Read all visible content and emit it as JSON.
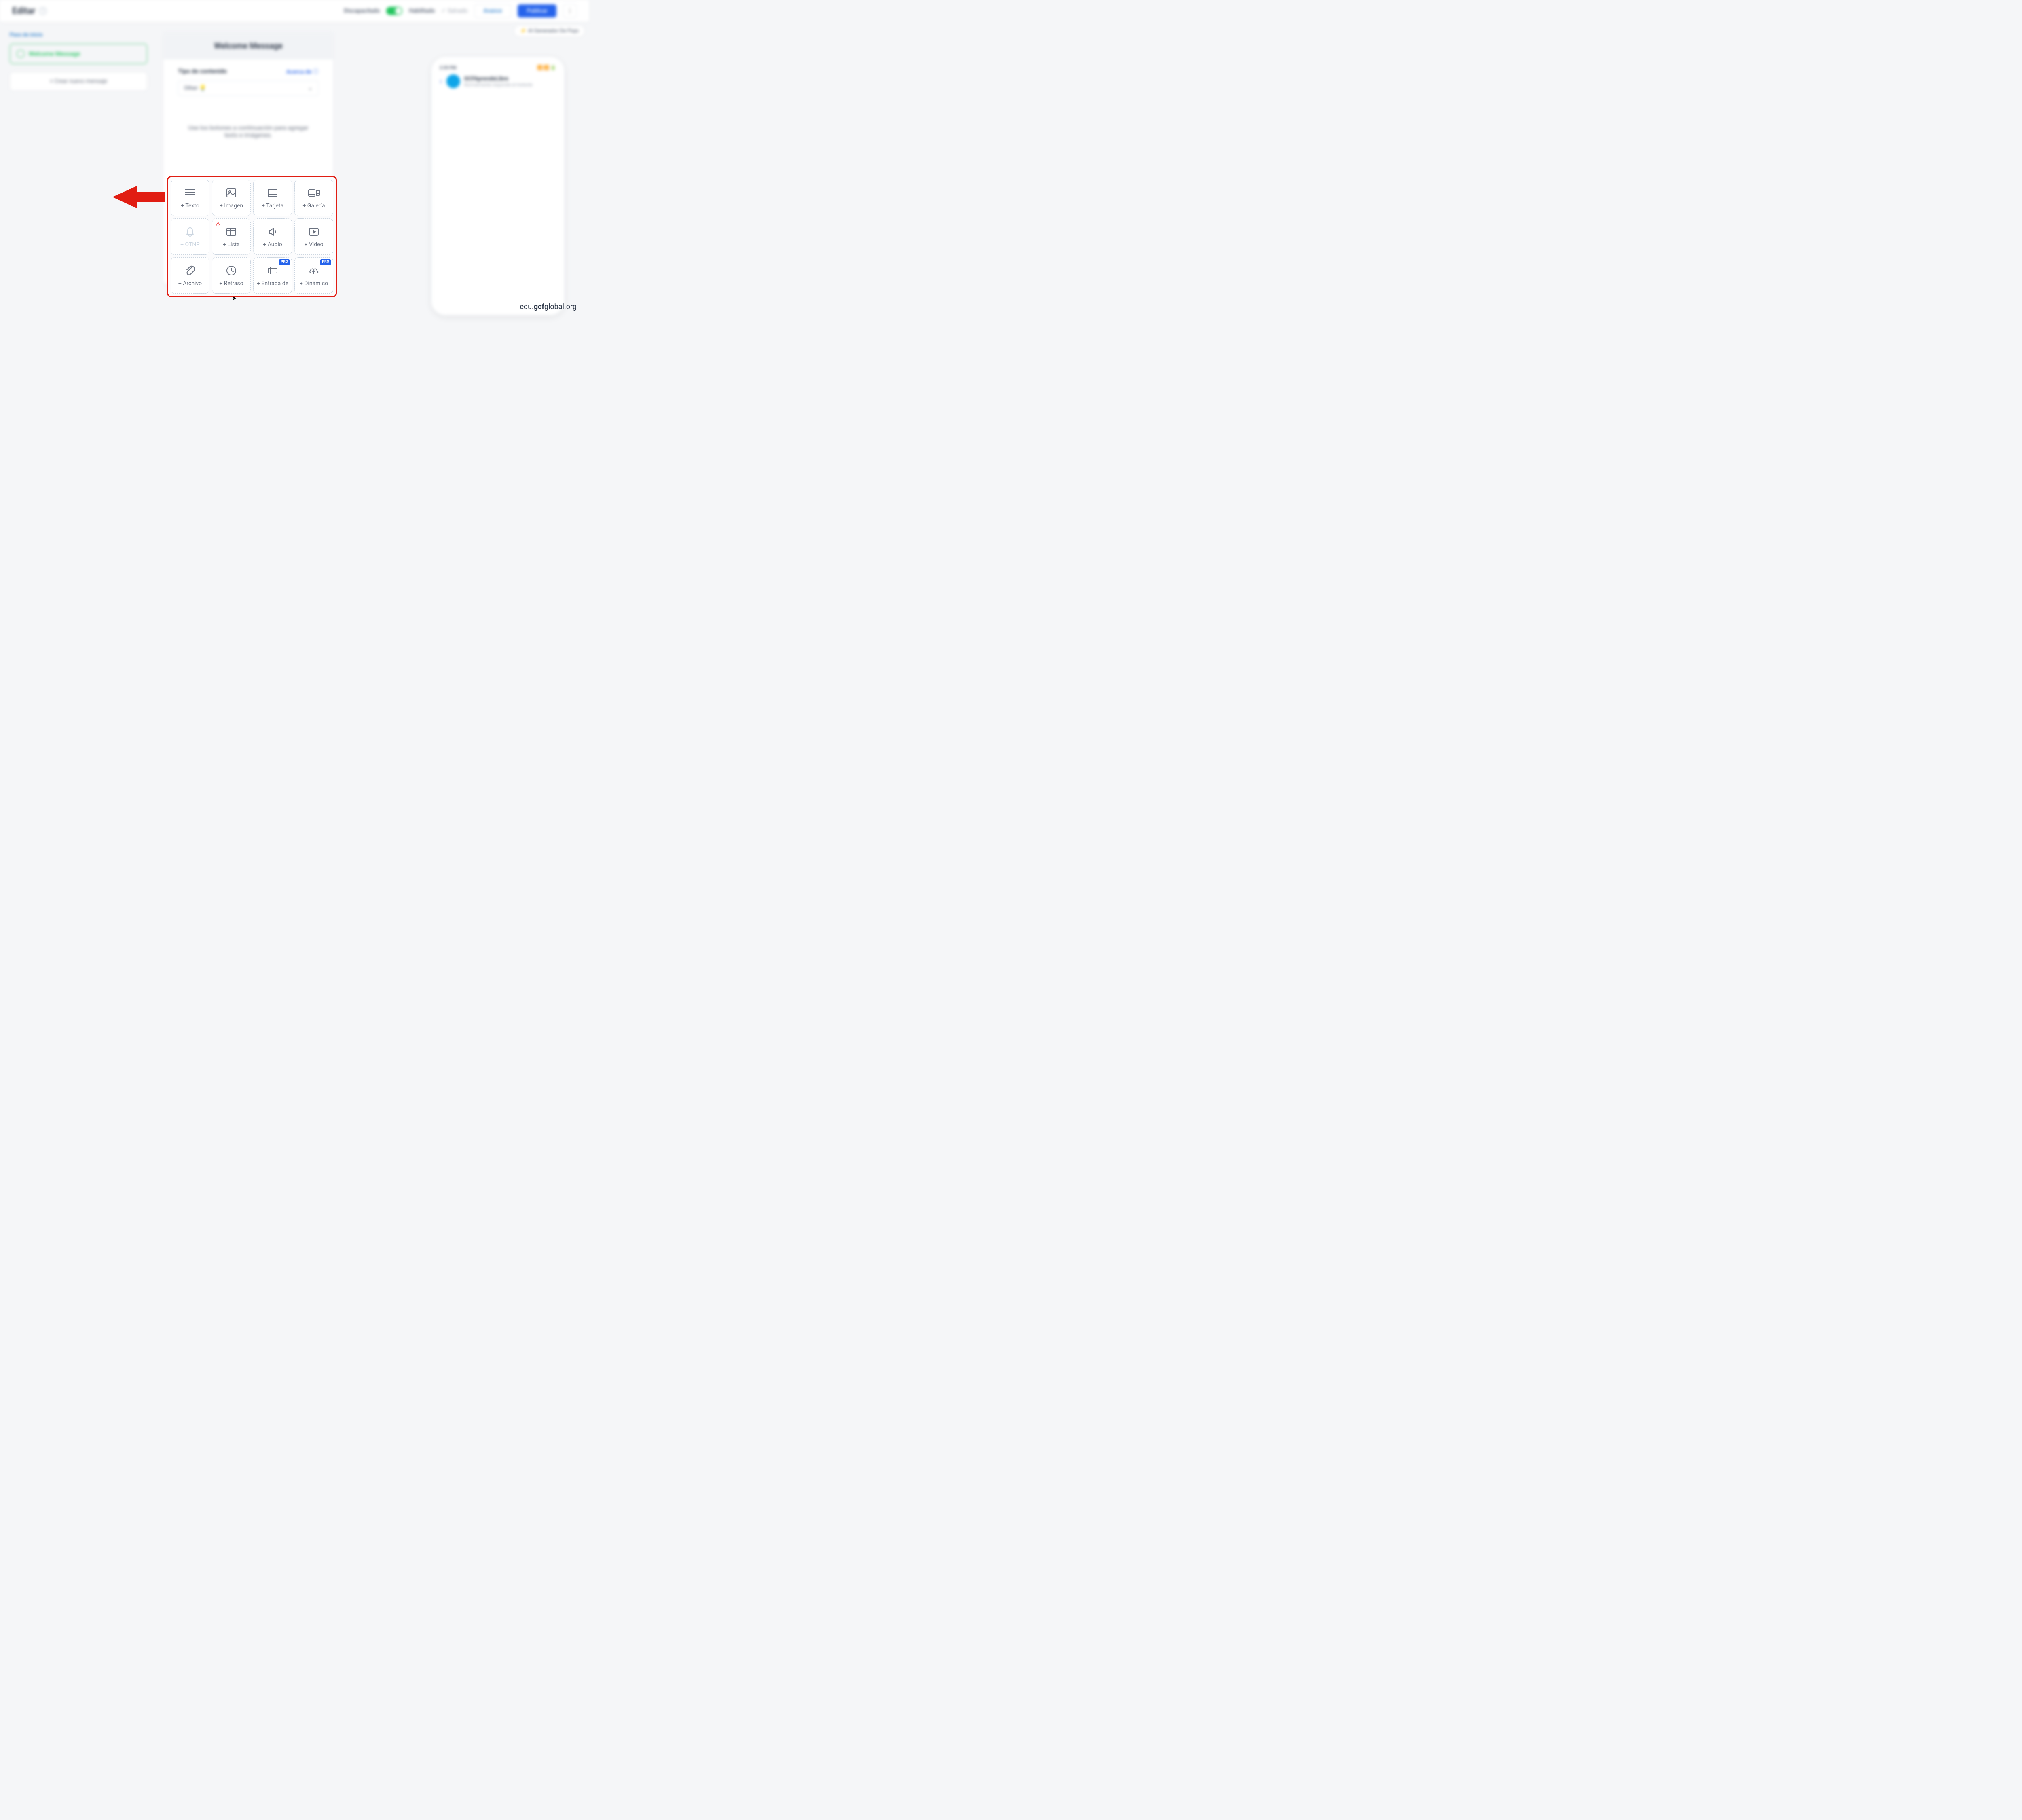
{
  "topbar": {
    "title": "Editar",
    "disabled_label": "Discapacitado",
    "enabled_label": "Habilitado",
    "saved_label": "Salvado",
    "advance_btn": "Avance",
    "publish_btn": "Publicar"
  },
  "pill": {
    "label": "⚡ AI Generador De Flujo"
  },
  "left": {
    "section": "Paso de inicio",
    "step_name": "Welcome Message",
    "create_btn": "+ Crear nuevo mensaje"
  },
  "center": {
    "header": "Welcome Message",
    "content_type_label": "Tipo de contenido",
    "about_link": "Acerca de ⓘ",
    "select_value": "Other 💡",
    "hint": "Use los botones a continuación para agregar texto e imágenes."
  },
  "phone": {
    "time": "2:39 PM",
    "indicators": "📶 📶 🔋",
    "name": "GCFAprendeLibre",
    "subtitle": "Normalmente responde al instante"
  },
  "tiles": [
    {
      "key": "text",
      "label": "+ Texto",
      "icon": "text-lines-icon"
    },
    {
      "key": "image",
      "label": "+ Imagen",
      "icon": "image-icon"
    },
    {
      "key": "card",
      "label": "+ Tarjeta",
      "icon": "card-icon"
    },
    {
      "key": "gallery",
      "label": "+ Galería",
      "icon": "gallery-icon"
    },
    {
      "key": "otnr",
      "label": "+ OTNR",
      "icon": "bell-icon",
      "disabled": true
    },
    {
      "key": "list",
      "label": "+ Lista",
      "icon": "table-icon",
      "warn": true
    },
    {
      "key": "audio",
      "label": "+ Audio",
      "icon": "speaker-icon"
    },
    {
      "key": "video",
      "label": "+ Video",
      "icon": "play-icon"
    },
    {
      "key": "file",
      "label": "+ Archivo",
      "icon": "clip-icon"
    },
    {
      "key": "delay",
      "label": "+ Retraso",
      "icon": "clock-icon"
    },
    {
      "key": "input",
      "label": "+ Entrada de",
      "icon": "input-icon",
      "pro": true
    },
    {
      "key": "dynamic",
      "label": "+ Dinámico",
      "icon": "cloud-icon",
      "pro": true
    }
  ],
  "badges": {
    "pro": "PRO"
  },
  "watermark": {
    "pre": "edu.",
    "bold": "gcf",
    "post": "global.org"
  }
}
